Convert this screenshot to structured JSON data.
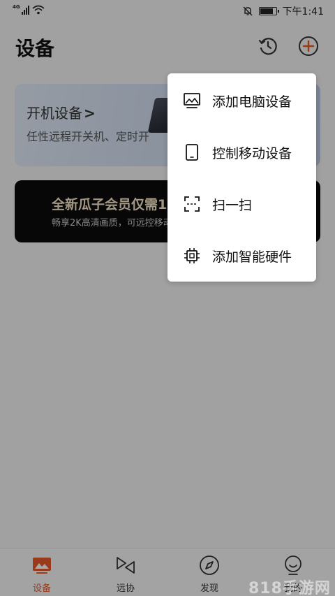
{
  "status_bar": {
    "network": "4G",
    "time": "下午1:41",
    "battery_level": 0.9
  },
  "header": {
    "title": "设备",
    "icons": [
      "history-icon",
      "add-circle-icon"
    ]
  },
  "power_card": {
    "title": "开机设备",
    "chevron": ">",
    "desc": "任性远程开关机、定时开"
  },
  "vip_card": {
    "title": "全新瓜子会员仅需1",
    "desc": "畅享2K高清画质，可远控移动"
  },
  "popup_menu": {
    "items": [
      {
        "label": "添加电脑设备",
        "icon": "computer-icon"
      },
      {
        "label": "控制移动设备",
        "icon": "tablet-icon"
      },
      {
        "label": "扫一扫",
        "icon": "scan-icon"
      },
      {
        "label": "添加智能硬件",
        "icon": "chip-icon"
      }
    ]
  },
  "bottom_nav": {
    "items": [
      {
        "label": "设备",
        "icon": "device-icon",
        "active": true
      },
      {
        "label": "远协",
        "icon": "remote-assist-icon",
        "active": false
      },
      {
        "label": "发现",
        "icon": "compass-icon",
        "active": false
      },
      {
        "label": "我的",
        "icon": "profile-icon",
        "active": false
      }
    ]
  },
  "watermark": "818手游网",
  "colors": {
    "accent": "#e8592a",
    "vip_text": "#f5e6c8",
    "overlay": "rgba(0,0,0,0.34)"
  }
}
